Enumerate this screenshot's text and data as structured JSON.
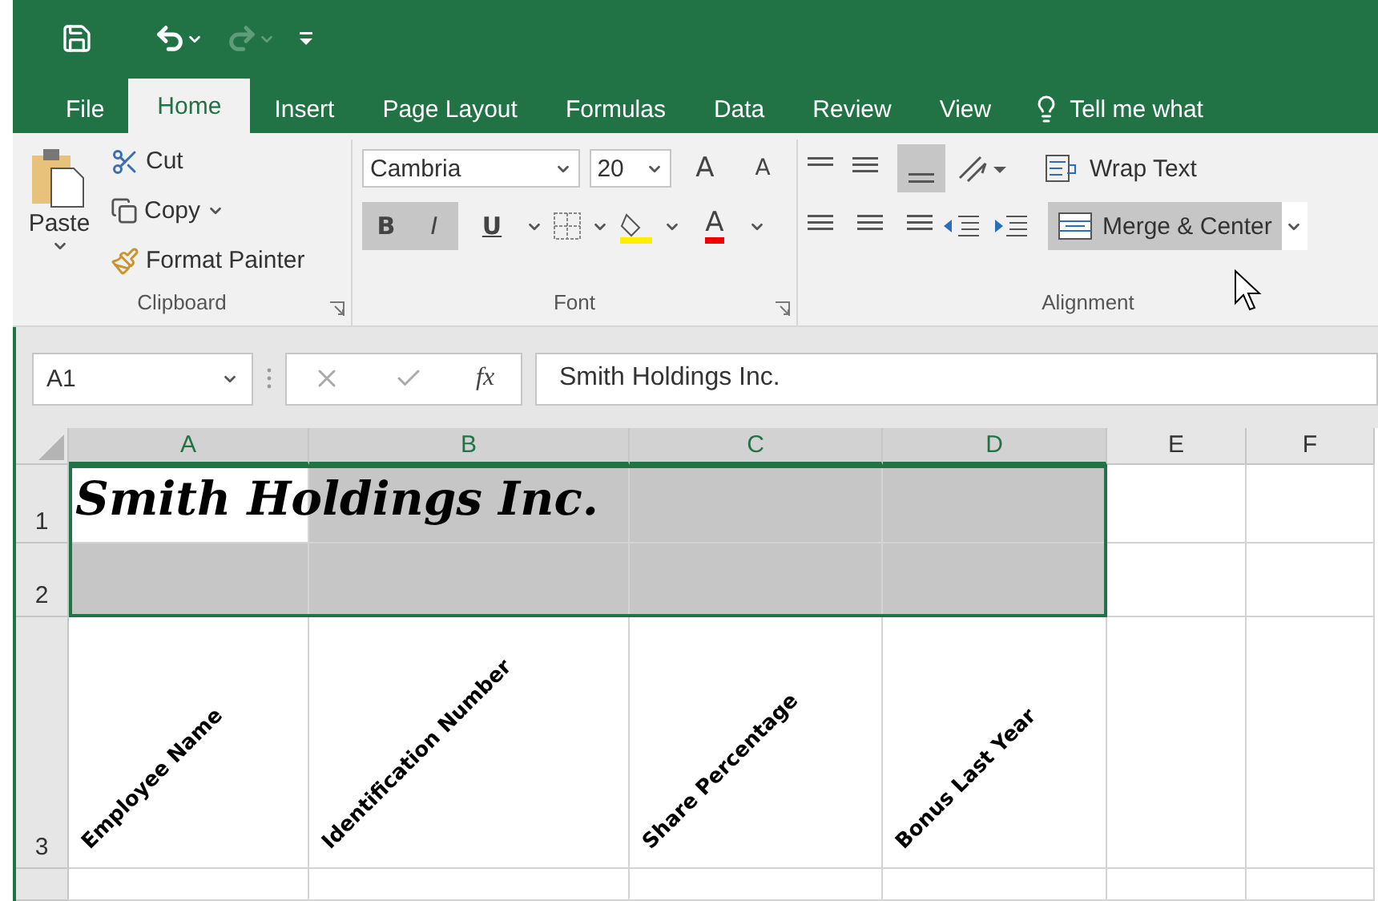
{
  "quick_access": {
    "redo_disabled": true
  },
  "tabs": [
    {
      "label": "File",
      "selected": false
    },
    {
      "label": "Home",
      "selected": true
    },
    {
      "label": "Insert",
      "selected": false
    },
    {
      "label": "Page Layout",
      "selected": false
    },
    {
      "label": "Formulas",
      "selected": false
    },
    {
      "label": "Data",
      "selected": false
    },
    {
      "label": "Review",
      "selected": false
    },
    {
      "label": "View",
      "selected": false
    }
  ],
  "tell_me": "Tell me what",
  "clipboard": {
    "paste": "Paste",
    "cut": "Cut",
    "copy": "Copy",
    "format_painter": "Format Painter",
    "label": "Clipboard"
  },
  "font": {
    "name": "Cambria",
    "size": "20",
    "bold": true,
    "italic": true,
    "bold_key": "B",
    "italic_key": "I",
    "underline_key": "U",
    "label": "Font",
    "increase_size": "A",
    "decrease_size": "A",
    "font_color": "A"
  },
  "alignment": {
    "bottom_align": true,
    "wrap_text": "Wrap Text",
    "merge_center": "Merge & Center",
    "merge_highlighted": true,
    "label": "Alignment"
  },
  "formula_bar": {
    "name_box": "A1",
    "function_key": "fx",
    "formula": "Smith Holdings Inc."
  },
  "sheet": {
    "columns": [
      {
        "label": "A",
        "selected": true
      },
      {
        "label": "B",
        "selected": true
      },
      {
        "label": "C",
        "selected": true
      },
      {
        "label": "D",
        "selected": true
      },
      {
        "label": "E",
        "selected": false
      },
      {
        "label": "F",
        "selected": false
      }
    ],
    "title": "Smith Holdings Inc.",
    "rows": [
      {
        "label": "1"
      },
      {
        "label": "2"
      },
      {
        "label": "3"
      }
    ],
    "headers": [
      "Employee Name",
      "Identification Number",
      "Share Percentage",
      "Bonus Last Year"
    ]
  }
}
